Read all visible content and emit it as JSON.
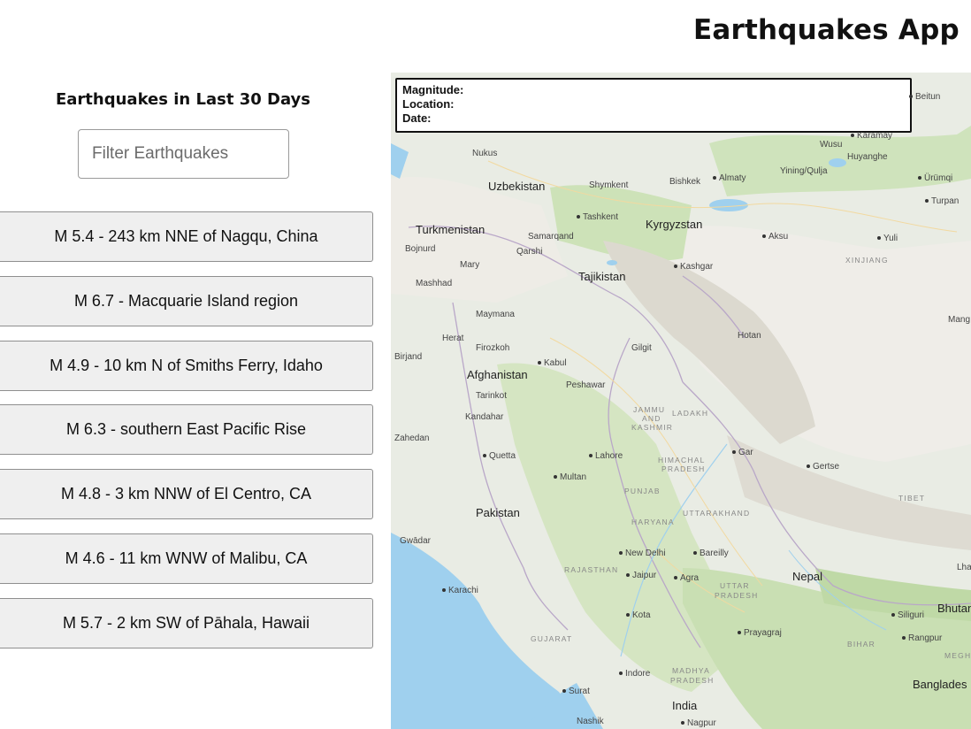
{
  "header": {
    "title": "Earthquakes App"
  },
  "sidebar": {
    "heading": "Earthquakes in Last 30 Days",
    "filter": {
      "placeholder": "Filter Earthquakes",
      "value": ""
    },
    "earthquakes": [
      "M 5.4 - 243 km NNE of Nagqu, China",
      "M 6.7 - Macquarie Island region",
      "M 4.9 - 10 km N of Smiths Ferry, Idaho",
      "M 6.3 - southern East Pacific Rise",
      "M 4.8 - 3 km NNW of El Centro, CA",
      "M 4.6 - 11 km WNW of Malibu, CA",
      "M 5.7 - 2 km SW of Pāhala, Hawaii"
    ]
  },
  "map": {
    "info": {
      "magnitude_label": "Magnitude:",
      "location_label": "Location:",
      "date_label": "Date:"
    },
    "colors": {
      "land": "#e9ece4",
      "vegetation": "#c9dfb3",
      "water": "#9fd0ee",
      "mountain": "#dcd9cf",
      "border": "#b9a7c8"
    },
    "labels": {
      "beitun": "Beitun",
      "karamay": "Karamay",
      "nukus": "Nukus",
      "wusu": "Wusu",
      "yining": "Yining/Qulja",
      "huyanghe": "Huyanghe",
      "urumqi": "Ürümqi",
      "uzbekistan": "Uzbekistan",
      "shymkent": "Shymkent",
      "bishkek": "Bishkek",
      "almaty": "Almaty",
      "turpan": "Turpan",
      "tashkent": "Tashkent",
      "kyrgyzstan": "Kyrgyzstan",
      "turkmenistan": "Turkmenistan",
      "samarqand": "Samarqand",
      "aksu": "Aksu",
      "yuli": "Yuli",
      "bojnurd": "Bojnurd",
      "qarshi": "Qarshi",
      "xinjiang": "XINJIANG",
      "mary": "Mary",
      "kashgar": "Kashgar",
      "tajikistan": "Tajikistan",
      "mashhad": "Mashhad",
      "mang": "Mang",
      "maymana": "Maymana",
      "hotan": "Hotan",
      "herat": "Herat",
      "firozkoh": "Firozkoh",
      "gilgit": "Gilgit",
      "birjand": "Birjand",
      "kabul": "Kabul",
      "afghanistan": "Afghanistan",
      "peshawar": "Peshawar",
      "tarinkot": "Tarinkot",
      "jammu": "JAMMU",
      "and": "AND",
      "kashmir": "KASHMIR",
      "ladakh": "LADAKH",
      "kandahar": "Kandahar",
      "zahedan": "Zahedan",
      "quetta": "Quetta",
      "lahore": "Lahore",
      "gar": "Gar",
      "himachal": "HIMACHAL",
      "pradesh1": "PRADESH",
      "gertse": "Gertse",
      "multan": "Multan",
      "punjab": "PUNJAB",
      "tibet": "TIBET",
      "pakistan": "Pakistan",
      "uttarakhand": "UTTARAKHAND",
      "haryana": "HARYANA",
      "gwadar": "Gwādar",
      "bareilly": "Bareilly",
      "lha": "Lha",
      "newdelhi": "New Delhi",
      "rajasthan": "RAJASTHAN",
      "jaipur": "Jaipur",
      "nepal": "Nepal",
      "agra": "Agra",
      "karachi": "Karachi",
      "uttar": "UTTAR",
      "pradesh2": "PRADESH",
      "siliguri": "Siliguri",
      "bhutan": "Bhutan",
      "kota": "Kota",
      "gujarat": "GUJARAT",
      "prayagraj": "Prayagraj",
      "bihar": "BIHAR",
      "rangpur": "Rangpur",
      "meghal": "MEGHAL",
      "indore": "Indore",
      "madhya": "MADHYA",
      "pradesh3": "PRADESH",
      "banglades": "Banglades",
      "surat": "Surat",
      "india": "India",
      "nashik": "Nashik",
      "nagpur": "Nagpur"
    }
  }
}
